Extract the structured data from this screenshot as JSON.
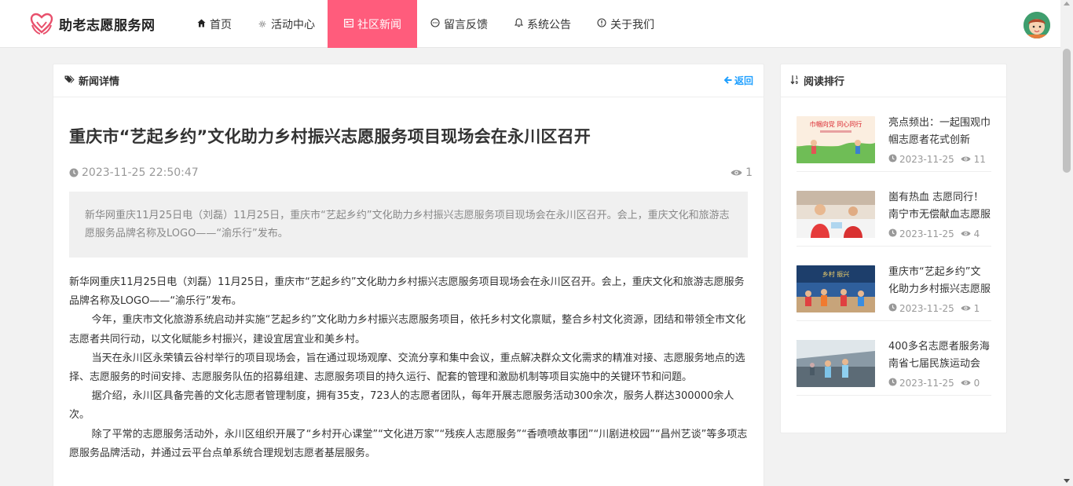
{
  "site": {
    "name": "助老志愿服务网"
  },
  "nav": [
    {
      "label": "首页",
      "icon": "home-icon",
      "active": false
    },
    {
      "label": "活动中心",
      "icon": "sun-icon",
      "active": false
    },
    {
      "label": "社区新闻",
      "icon": "newspaper-icon",
      "active": true
    },
    {
      "label": "留言反馈",
      "icon": "chat-icon",
      "active": false
    },
    {
      "label": "系统公告",
      "icon": "bell-icon",
      "active": false
    },
    {
      "label": "关于我们",
      "icon": "info-icon",
      "active": false
    }
  ],
  "colors": {
    "accent": "#ff5c7c",
    "link": "#1e9fff"
  },
  "detail": {
    "header": "新闻详情",
    "back": "返回",
    "title": "重庆市“艺起乡约”文化助力乡村振兴志愿服务项目现场会在永川区召开",
    "datetime": "2023-11-25 22:50:47",
    "views": "1",
    "summary": "新华网重庆11月25日电（刘磊）11月25日，重庆市“艺起乡约”文化助力乡村振兴志愿服务项目现场会在永川区召开。会上，重庆文化和旅游志愿服务品牌名称及LOGO——“渝乐行”发布。",
    "paragraphs": [
      "新华网重庆11月25日电（刘磊）11月25日，重庆市“艺起乡约”文化助力乡村振兴志愿服务项目现场会在永川区召开。会上，重庆文化和旅游志愿服务品牌名称及LOGO——“渝乐行”发布。",
      "今年，重庆市文化旅游系统启动并实施“艺起乡约”文化助力乡村振兴志愿服务项目，依托乡村文化禀赋，整合乡村文化资源，团结和带领全市文化志愿者共同行动，以文化赋能乡村振兴，建设宜居宜业和美乡村。",
      "当天在永川区永荣镇云谷村举行的项目现场会，旨在通过现场观摩、交流分享和集中会议，重点解决群众文化需求的精准对接、志愿服务地点的选择、志愿服务的时间安排、志愿服务队伍的招募组建、志愿服务项目的持久运行、配套的管理和激励机制等项目实施中的关键环节和问题。",
      "据介绍，永川区具备完善的文化志愿者管理制度，拥有35支，723人的志愿者团队，每年开展志愿服务活动300余次，服务人群达300000余人次。",
      "除了平常的志愿服务活动外，永川区组织开展了“乡村开心课堂”“文化进万家”“残疾人志愿服务”“香喷喷故事团”“川剧进校园”“昌州艺谈”等多项志愿服务品牌活动，并通过云平台点单系统合理规划志愿者基层服务。"
    ]
  },
  "ranking": {
    "header": "阅读排行",
    "items": [
      {
        "title": "亮点频出：一起围观巾帼志愿者花式创新",
        "date": "2023-11-25",
        "views": "11",
        "thumb_text": "巾帼向党 同心同行"
      },
      {
        "title": "崮有热血 志愿同行！南宁市无偿献血志愿服务",
        "date": "2023-11-25",
        "views": "4",
        "thumb_text": ""
      },
      {
        "title": "重庆市“艺起乡约”文化助力乡村振兴志愿服务",
        "date": "2023-11-25",
        "views": "1",
        "thumb_text": "乡村 振兴"
      },
      {
        "title": "400多名志愿者服务海南省七届民族运动会",
        "date": "2023-11-25",
        "views": "0",
        "thumb_text": ""
      }
    ]
  }
}
